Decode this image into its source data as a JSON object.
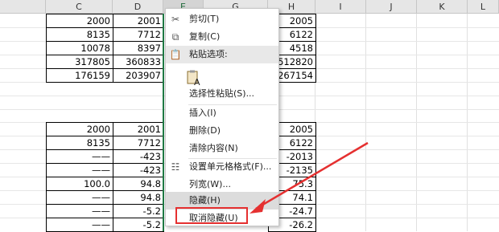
{
  "columns": [
    "C",
    "D",
    "E",
    "G",
    "H",
    "I",
    "J",
    "K",
    "L"
  ],
  "col_c": [
    "2000",
    "8135",
    "10078",
    "317805",
    "176159",
    "2000",
    "8135",
    "——",
    "——",
    "100.0",
    "——",
    "——",
    "——"
  ],
  "col_d": [
    "2001",
    "7712",
    "8397",
    "360833",
    "203907",
    "2001",
    "7712",
    "-423",
    "-423",
    "94.8",
    "94.8",
    "-5.2",
    "-5.2"
  ],
  "col_h": [
    "2005",
    "6122",
    "4518",
    "512820",
    "267154",
    "2005",
    "6122",
    "-2013",
    "-2135",
    "75.3",
    "74.1",
    "-24.7",
    "-26.2"
  ],
  "menu": {
    "cut": "剪切(T)",
    "copy": "复制(C)",
    "paste_options": "粘贴选项:",
    "paste_special": "选择性粘贴(S)...",
    "insert": "插入(I)",
    "delete": "删除(D)",
    "clear_contents": "清除内容(N)",
    "format_cells": "设置单元格格式(F)...",
    "column_width": "列宽(W)...",
    "hide": "隐藏(H)",
    "unhide": "取消隐藏(U)"
  },
  "colors": {
    "arrow": "#e53030",
    "selection": "#1f7a44"
  },
  "icons": [
    "scissors-icon",
    "copy-icon",
    "clipboard-icon",
    "paste-text-icon",
    "format-cells-icon"
  ]
}
